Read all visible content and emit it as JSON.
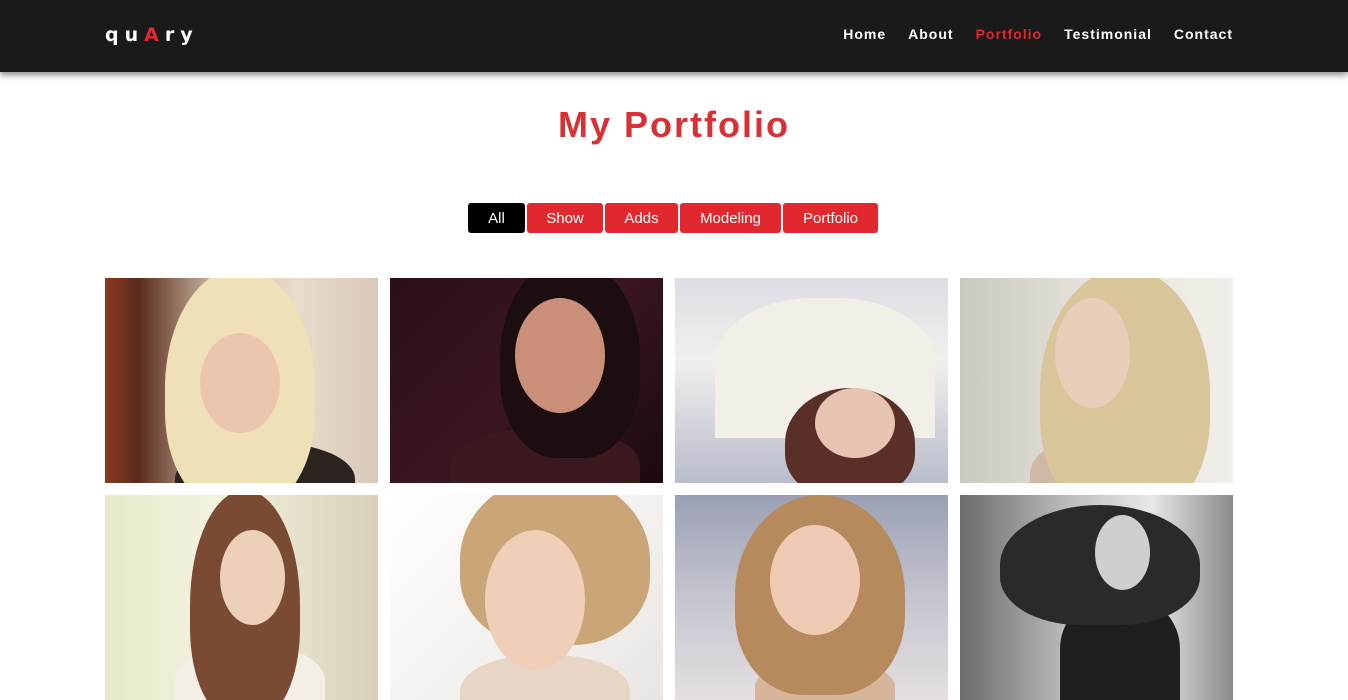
{
  "nav": {
    "logo": {
      "part1": "qu",
      "accent": "A",
      "part2": "ry"
    },
    "links": [
      {
        "label": "Home",
        "active": false
      },
      {
        "label": "About",
        "active": false
      },
      {
        "label": "Portfolio",
        "active": true
      },
      {
        "label": "Testimonial",
        "active": false
      },
      {
        "label": "Contact",
        "active": false
      }
    ]
  },
  "title": "My Portfolio",
  "filters": [
    {
      "label": "All",
      "selected": true
    },
    {
      "label": "Show",
      "selected": false
    },
    {
      "label": "Adds",
      "selected": false
    },
    {
      "label": "Modeling",
      "selected": false
    },
    {
      "label": "Portfolio",
      "selected": false
    }
  ],
  "colors": {
    "accent": "#e0282e",
    "title": "#d93035",
    "navbar": "#1a1a1a",
    "selected_filter": "#000000"
  },
  "gallery": [
    {
      "name": "portfolio-photo-1",
      "bg": "linear-gradient(90deg,#8a3b22 0%,#5a2a1c 12%,#c9b7a3 40%,#e8dccb 70%,#d9c9b9 100%)",
      "hair": "#efe0b8",
      "face": "#e9c6ad",
      "body": "#2b2320"
    },
    {
      "name": "portfolio-photo-2",
      "bg": "linear-gradient(135deg,#2a0f16 0%,#3a1620 50%,#1a0a0f 100%)",
      "hair": "#1c0d10",
      "face": "#c98f78",
      "body": "#3a1a1e"
    },
    {
      "name": "portfolio-photo-3",
      "bg": "linear-gradient(180deg,#dcdde4 0%,#f1f0ee 40%,#b8bccb 100%)",
      "hair": "#5a2f28",
      "face": "#e7c3b1",
      "body": "#f2efe8"
    },
    {
      "name": "portfolio-photo-4",
      "bg": "linear-gradient(90deg,#c9c8c0 0%,#e6e4dc 50%,#f0efe9 100%)",
      "hair": "#d9c59a",
      "face": "#e8cdb8",
      "body": "#cdb9a5"
    },
    {
      "name": "portfolio-photo-5",
      "bg": "linear-gradient(90deg,#e7e9c9 0%,#f3f2df 40%,#d7d0b8 100%)",
      "hair": "#7a4a33",
      "face": "#edd0b8",
      "body": "#f3efe6"
    },
    {
      "name": "portfolio-photo-6",
      "bg": "linear-gradient(135deg,#ffffff 0%,#f4f2f0 50%,#e9e5e2 100%)",
      "hair": "#c9a577",
      "face": "#f0cfb9",
      "body": "#e8d5c6"
    },
    {
      "name": "portfolio-photo-7",
      "bg": "linear-gradient(180deg,#9a9fb4 0%,#c4c5cf 50%,#e5dfe2 100%)",
      "hair": "#b78a5e",
      "face": "#efcbb6",
      "body": "#d7b59a"
    },
    {
      "name": "portfolio-photo-8",
      "bg": "linear-gradient(90deg,#6b6b6b 0%,#bdbdbd 40%,#e8e8e8 70%,#8a8a8a 100%)",
      "hair": "#2a2a2a",
      "face": "#cfcfcf",
      "body": "#1f1f1f"
    }
  ]
}
